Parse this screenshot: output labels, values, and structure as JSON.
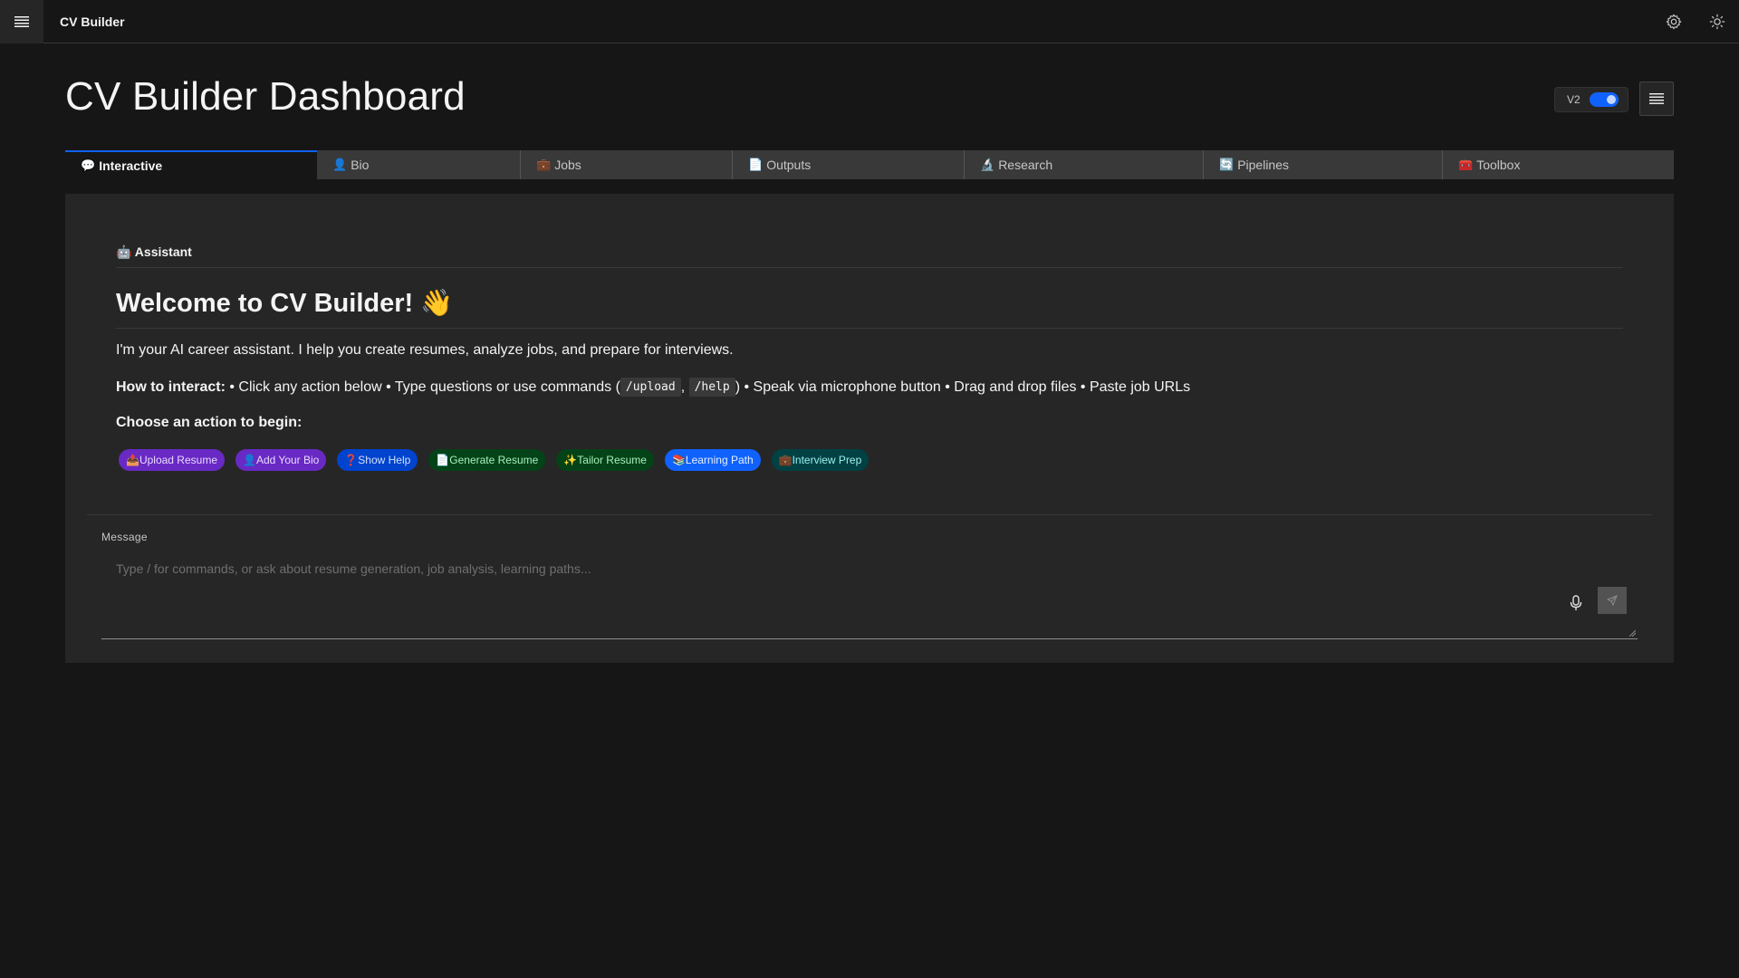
{
  "header": {
    "app_title": "CV Builder",
    "menu_icon": "hamburger-icon",
    "settings_icon": "gear-icon",
    "theme_icon": "sun-icon"
  },
  "page": {
    "title": "CV Builder Dashboard",
    "version_toggle": {
      "label": "V2",
      "on": true
    },
    "layout_icon": "list-icon"
  },
  "tabs": [
    {
      "emoji": "💬",
      "label": "Interactive",
      "active": true
    },
    {
      "emoji": "👤",
      "label": "Bio"
    },
    {
      "emoji": "💼",
      "label": "Jobs"
    },
    {
      "emoji": "📄",
      "label": "Outputs"
    },
    {
      "emoji": "🔬",
      "label": "Research"
    },
    {
      "emoji": "🔄",
      "label": "Pipelines"
    },
    {
      "emoji": "🧰",
      "label": "Toolbox"
    }
  ],
  "assistant": {
    "header": "🤖 Assistant",
    "welcome": "Welcome to CV Builder! 👋",
    "intro": "I'm your AI career assistant. I help you create resumes, analyze jobs, and prepare for interviews.",
    "howto_label": "How to interact:",
    "howto_part1": " • Click any action below • Type questions or use commands (",
    "cmd_upload": "/upload",
    "comma": ", ",
    "cmd_help": "/help",
    "howto_part2": ") • Speak via microphone button • Drag and drop files • Paste job URLs",
    "choose": "Choose an action to begin:",
    "actions": [
      {
        "label": "📤Upload Resume",
        "color": "purple"
      },
      {
        "label": "👤Add Your Bio",
        "color": "purple"
      },
      {
        "label": "❓Show Help",
        "color": "blue"
      },
      {
        "label": "📄Generate Resume",
        "color": "green"
      },
      {
        "label": "✨Tailor Resume",
        "color": "green"
      },
      {
        "label": "📚Learning Path",
        "color": "brightblue"
      },
      {
        "label": "💼Interview Prep",
        "color": "teal"
      }
    ]
  },
  "message": {
    "label": "Message",
    "placeholder": "Type / for commands, or ask about resume generation, job analysis, learning paths...",
    "mic_icon": "microphone-icon",
    "send_icon": "send-icon"
  },
  "colors": {
    "background": "#161616",
    "panel": "#262626",
    "accent": "#0f62fe"
  }
}
